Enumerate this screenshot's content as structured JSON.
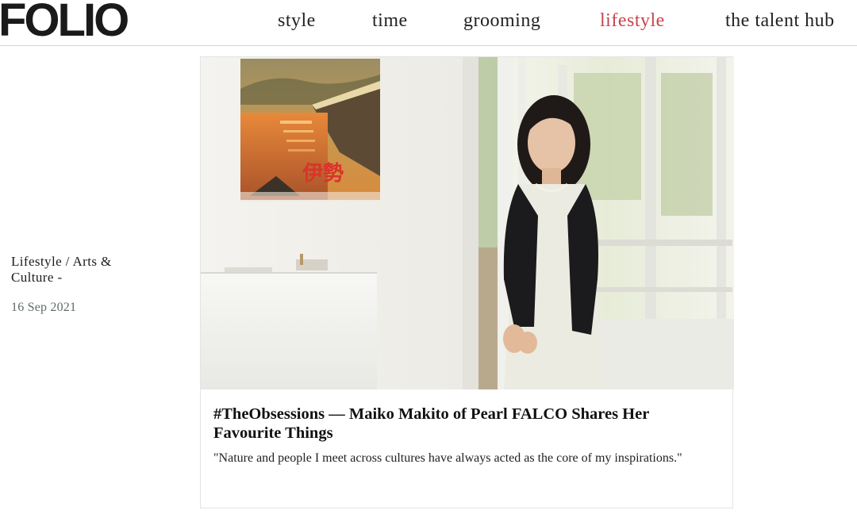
{
  "site": {
    "logo": "FOLIO"
  },
  "nav": {
    "items": [
      {
        "label": "style"
      },
      {
        "label": "time"
      },
      {
        "label": "grooming"
      },
      {
        "label": "lifestyle"
      },
      {
        "label": "the talent hub"
      }
    ],
    "active": "lifestyle",
    "active_color": "#c9444f"
  },
  "article": {
    "category": "Lifestyle / Arts & Culture -",
    "date": "16 Sep 2021",
    "title": "#TheObsessions — Maiko Makito of Pearl FALCO Shares Her Favourite Things",
    "excerpt": "\"Nature and people I meet across cultures have always acted as the core of my inspirations.\"",
    "poster_text": "伊勢"
  }
}
